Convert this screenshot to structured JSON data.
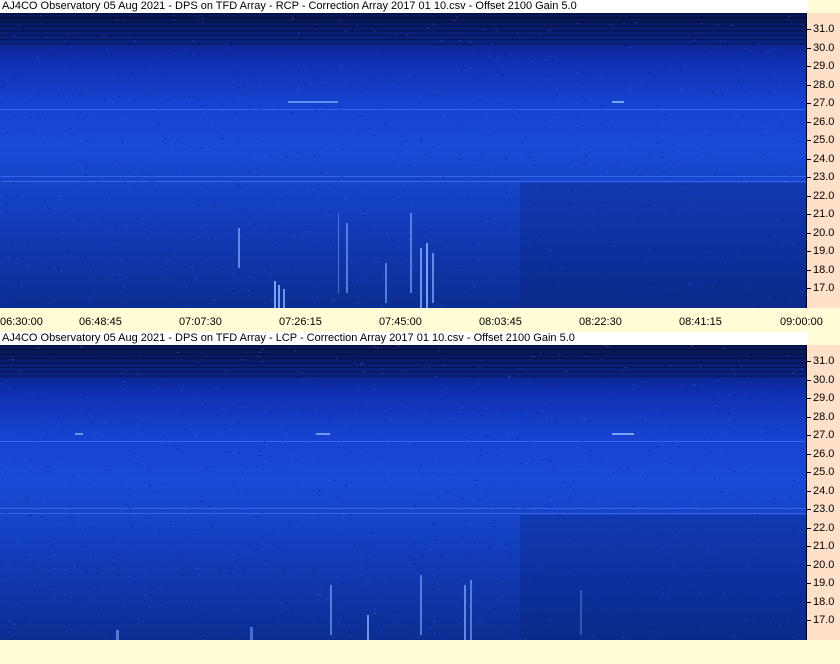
{
  "panels": [
    {
      "title": "AJ4CO Observatory 05 Aug 2021  -  DPS on TFD Array  -  RCP  -  Correction Array 2017 01 10.csv  -  Offset 2100  Gain 5.0"
    },
    {
      "title": "AJ4CO Observatory 05 Aug 2021  -  DPS on TFD Array  -  LCP  -  Correction Array 2017 01 10.csv  -  Offset 2100  Gain 5.0"
    }
  ],
  "freq_labels": [
    "31.0",
    "30.0",
    "29.0",
    "28.0",
    "27.0",
    "26.0",
    "25.0",
    "24.0",
    "23.0",
    "22.0",
    "21.0",
    "20.0",
    "19.0",
    "18.0",
    "17.0"
  ],
  "time_labels": [
    "06:30:00",
    "06:48:45",
    "07:07:30",
    "07:26:15",
    "07:45:00",
    "08:03:45",
    "08:22:30",
    "08:41:15",
    "09:00:00"
  ],
  "colors": {
    "background": "#fffcd6",
    "axis_panel": "#ffe0c8",
    "spectro_dark": "#061242",
    "spectro_mid": "#1a49d6"
  }
}
